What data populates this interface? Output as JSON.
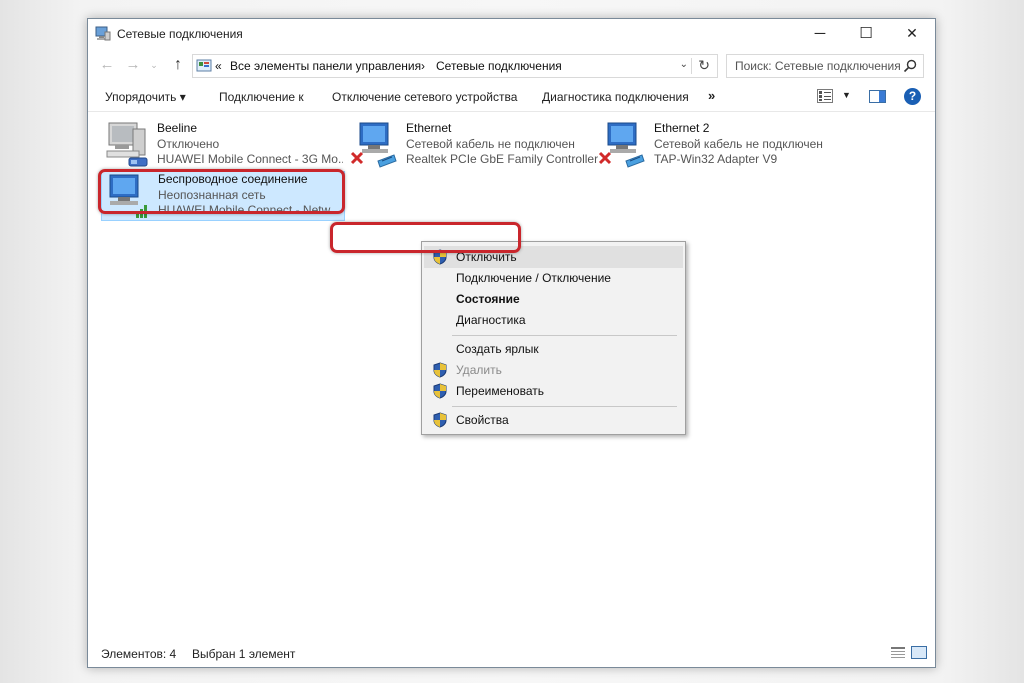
{
  "window": {
    "title": "Сетевые подключения",
    "buttons": {
      "minimize": "─",
      "maximize": "☐",
      "close": "✕"
    }
  },
  "navigation": {
    "back": "←",
    "forward": "→",
    "recent": "⌄",
    "up": "↑",
    "address_prefix": "«",
    "breadcrumb": [
      "Все элементы панели управления",
      "Сетевые подключения"
    ],
    "separator": "›",
    "dropdown": "⌄",
    "refresh": "↻",
    "search_placeholder": "Поиск: Сетевые подключения"
  },
  "toolbar": {
    "organize": "Упорядочить ▾",
    "connect_to": "Подключение к",
    "disable_device": "Отключение сетевого устройства",
    "diagnose": "Диагностика подключения",
    "more": "»",
    "view_dropdown": "▼",
    "help": "?"
  },
  "connections": [
    {
      "name": "Beeline",
      "status": "Отключено",
      "device": "HUAWEI Mobile Connect - 3G Mo...",
      "icon": "modem-icon",
      "state": "disconnected"
    },
    {
      "name": "Ethernet",
      "status": "Сетевой кабель не подключен",
      "device": "Realtek PCIe GbE Family Controller",
      "icon": "ethernet-icon",
      "state": "cable-unplugged"
    },
    {
      "name": "Ethernet 2",
      "status": "Сетевой кабель не подключен",
      "device": "TAP-Win32 Adapter V9",
      "icon": "ethernet-icon",
      "state": "cable-unplugged"
    },
    {
      "name": "Беспроводное соединение",
      "status": "Неопознанная сеть",
      "device": "HUAWEI Mobile Connect - Netw...",
      "icon": "wireless-icon",
      "state": "selected"
    }
  ],
  "context_menu": {
    "items": [
      {
        "label": "Отключить",
        "shield": true,
        "style": "highlighted"
      },
      {
        "label": "Подключение / Отключение",
        "shield": false,
        "style": "normal"
      },
      {
        "label": "Состояние",
        "shield": false,
        "style": "bold"
      },
      {
        "label": "Диагностика",
        "shield": false,
        "style": "normal"
      },
      {
        "label": "Создать ярлык",
        "shield": false,
        "style": "normal"
      },
      {
        "label": "Удалить",
        "shield": true,
        "style": "disabled"
      },
      {
        "label": "Переименовать",
        "shield": true,
        "style": "normal"
      },
      {
        "label": "Свойства",
        "shield": true,
        "style": "normal"
      }
    ]
  },
  "statusbar": {
    "count": "Элементов: 4",
    "selection": "Выбран 1 элемент"
  },
  "colors": {
    "selection_bg": "#cde8ff",
    "highlight_ring": "#c9262c",
    "help_blue": "#1a5fb4"
  }
}
